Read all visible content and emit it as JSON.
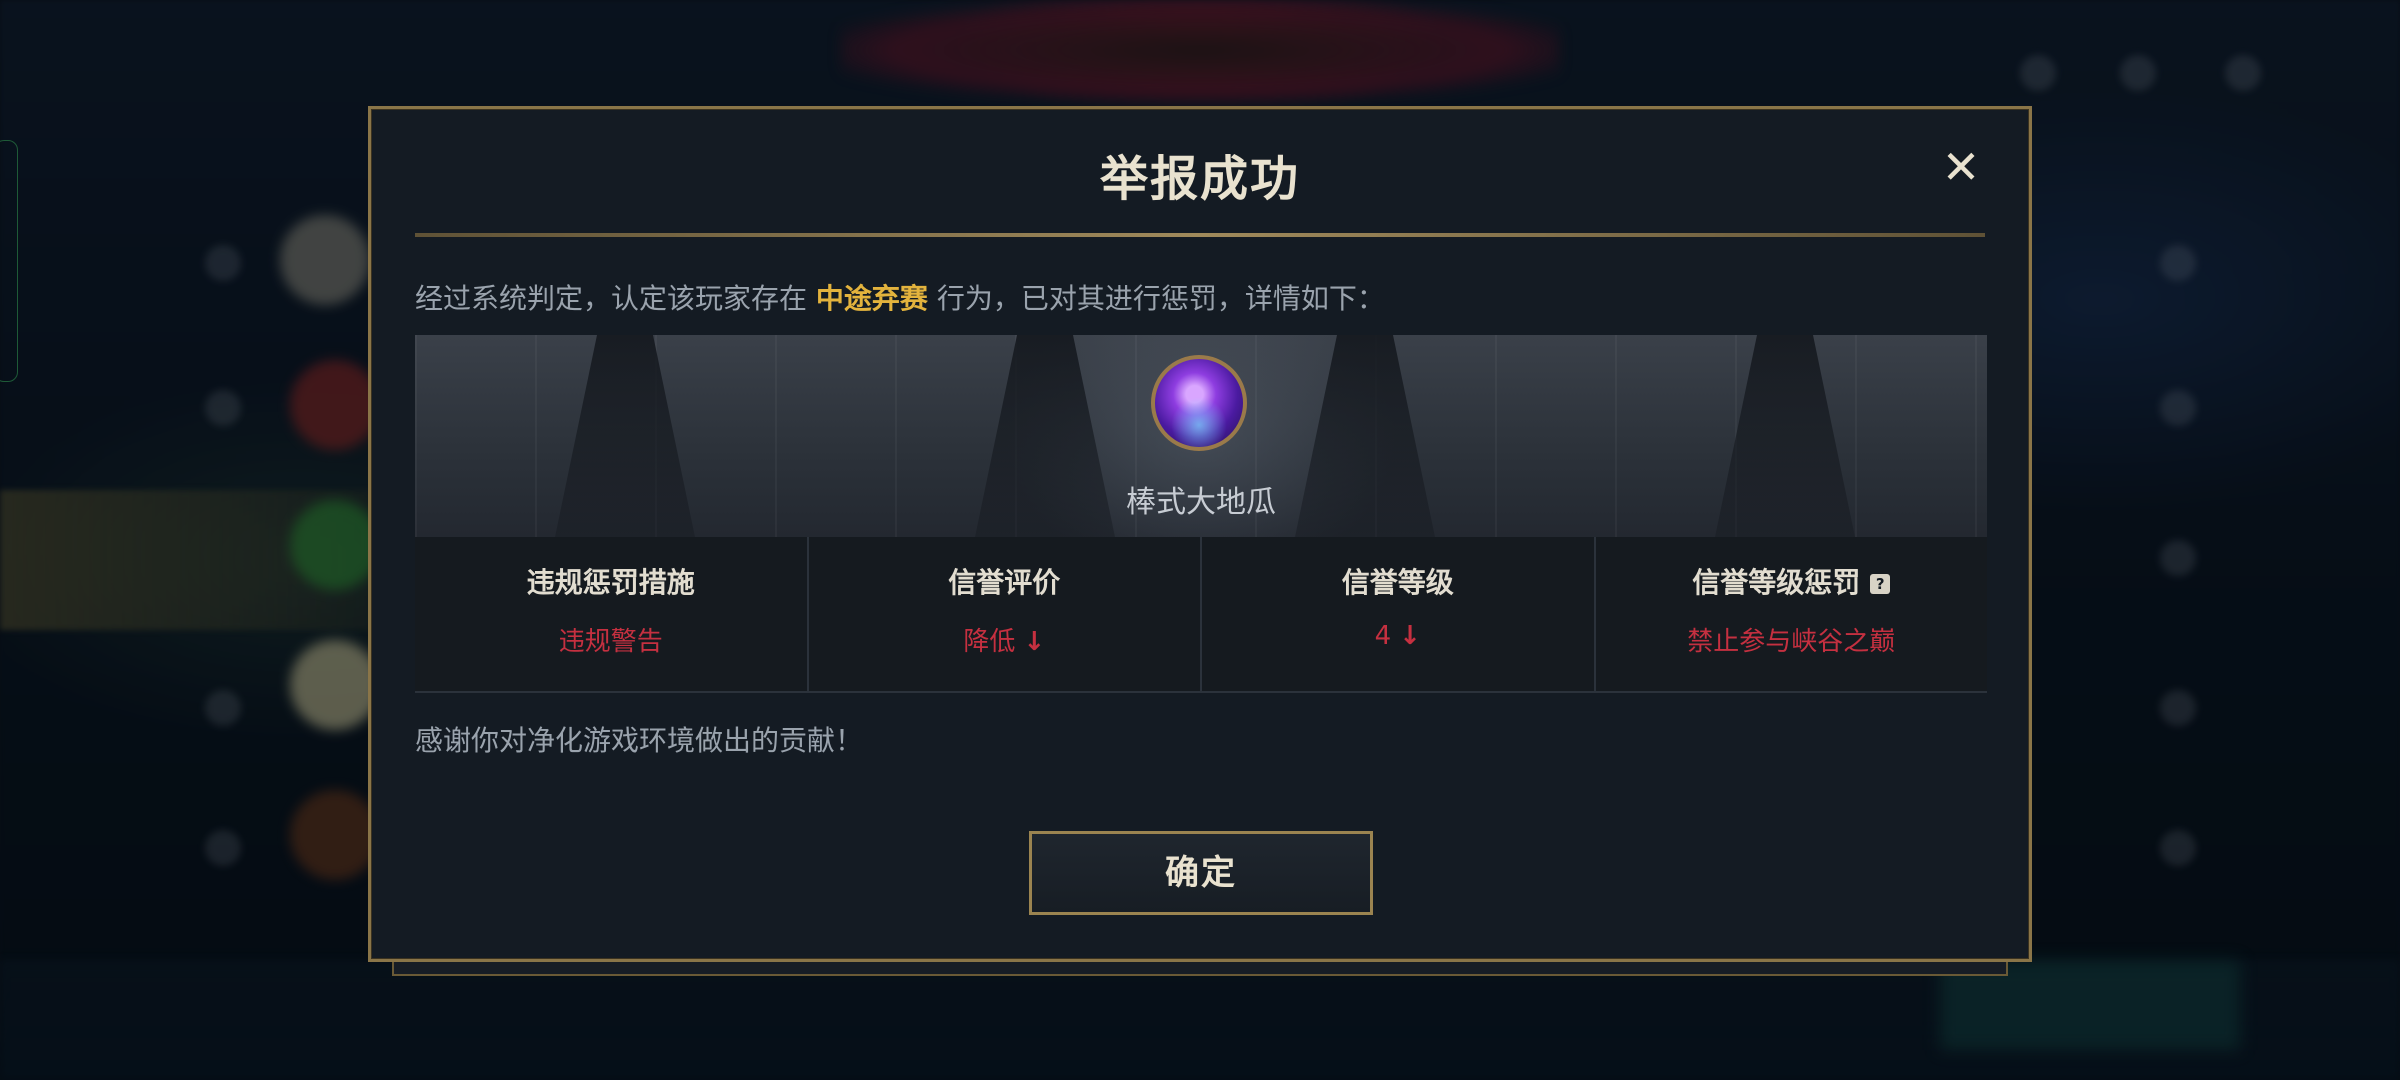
{
  "dialog": {
    "title": "举报成功",
    "description": {
      "prefix": "经过系统判定，认定该玩家存在 ",
      "highlight": "中途弃赛",
      "suffix": " 行为，已对其进行惩罚，详情如下："
    },
    "player": {
      "name": "棒式大地瓜",
      "avatar_icon": "purple-creature-avatar"
    },
    "penalty_table": [
      {
        "header": "违规惩罚措施",
        "value": "违规警告",
        "arrow": ""
      },
      {
        "header": "信誉评价",
        "value": "降低",
        "arrow": "↓"
      },
      {
        "header": "信誉等级",
        "value": "4",
        "arrow": "↓"
      },
      {
        "header": "信誉等级惩罚",
        "value": "禁止参与峡谷之巅",
        "arrow": "",
        "help_icon": "?"
      }
    ],
    "thanks": "感谢你对净化游戏环境做出的贡献！",
    "confirm_label": "确定",
    "close_icon": "✕"
  },
  "colors": {
    "highlight": "#e3b33d",
    "penalty_value": "#c53040",
    "border_gold": "#8a7548",
    "dialog_bg": "#141b23"
  }
}
